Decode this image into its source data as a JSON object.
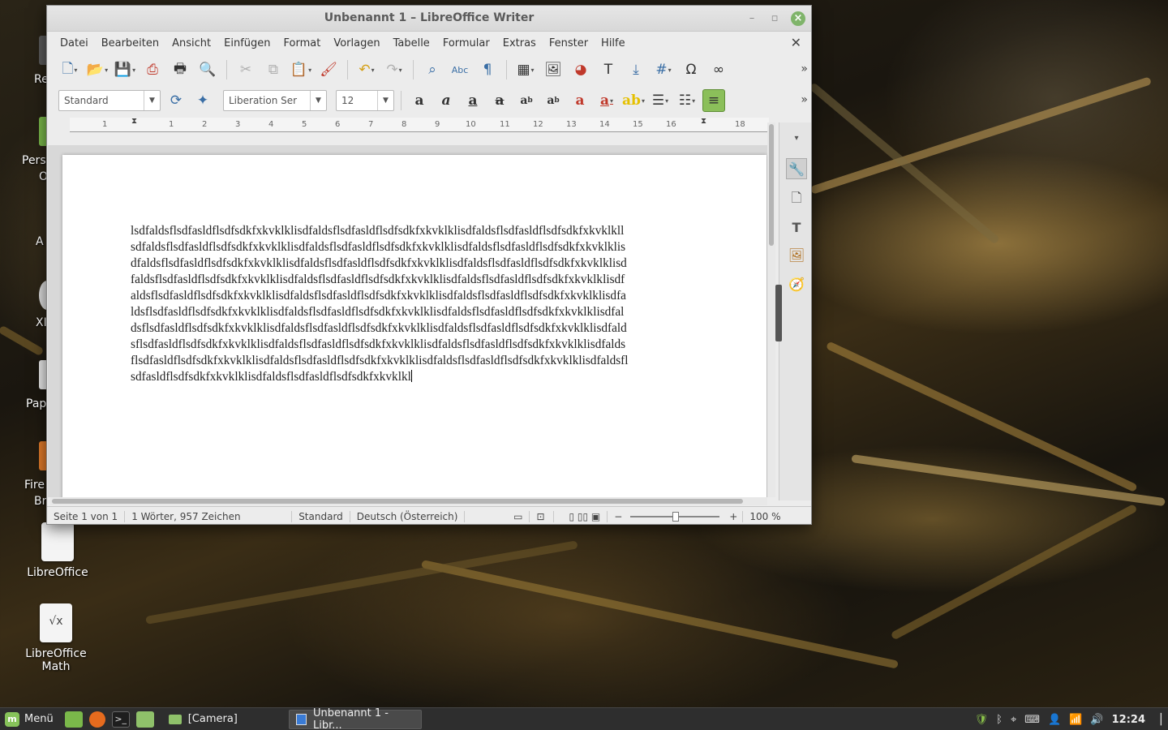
{
  "window": {
    "title": "Unbenannt 1 – LibreOffice Writer",
    "menus": [
      "Datei",
      "Bearbeiten",
      "Ansicht",
      "Einfügen",
      "Format",
      "Vorlagen",
      "Tabelle",
      "Formular",
      "Extras",
      "Fenster",
      "Hilfe"
    ],
    "paragraph_style": "Standard",
    "font_name": "Liberation Ser",
    "font_size": "12",
    "ruler_ticks": [
      "1",
      "1",
      "2",
      "3",
      "4",
      "5",
      "6",
      "7",
      "8",
      "9",
      "10",
      "11",
      "12",
      "13",
      "14",
      "15",
      "16",
      "17",
      "18"
    ]
  },
  "document": {
    "lines": [
      "lsdfaldsflsdfasldflsdfsdkfxkvklklisdfaldsflsdfasldflsdfsdkfxkvklklisdfaldsflsdfasldflsdfsdkfxkvklkll",
      "sdfaldsflsdfasldflsdfsdkfxkvklklisdfaldsflsdfasldflsdfsdkfxkvklklisdfaldsflsdfasldflsdfsdkfxkvklklis",
      "dfaldsflsdfasldflsdfsdkfxkvklklisdfaldsflsdfasldflsdfsdkfxkvklklisdfaldsflsdfasldflsdfsdkfxkvklklisd",
      "faldsflsdfasldflsdfsdkfxkvklklisdfaldsflsdfasldflsdfsdkfxkvklklisdfaldsflsdfasldflsdfsdkfxkvklklisdf",
      "aldsflsdfasldflsdfsdkfxkvklklisdfaldsflsdfasldflsdfsdkfxkvklklisdfaldsflsdfasldflsdfsdkfxkvklklisdfa",
      "ldsflsdfasldflsdfsdkfxkvklklisdfaldsflsdfasldflsdfsdkfxkvklklisdfaldsflsdfasldflsdfsdkfxkvklklisdfal",
      "dsflsdfasldflsdfsdkfxkvklklisdfaldsflsdfasldflsdfsdkfxkvklklisdfaldsflsdfasldflsdfsdkfxkvklklisdfald",
      "sflsdfasldflsdfsdkfxkvklklisdfaldsflsdfasldflsdfsdkfxkvklklisdfaldsflsdfasldflsdfsdkfxkvklklisdfalds",
      "flsdfasldflsdfsdkfxkvklklisdfaldsflsdfasldflsdfsdkfxkvklklisdfaldsflsdfasldflsdfsdkfxkvklklisdfaldsfl",
      "sdfasldflsdfsdkfxkvklklisdfaldsflsdfasldflsdfsdkfxkvklkl"
    ]
  },
  "status": {
    "page": "Seite 1 von 1",
    "words": "1 Wörter, 957 Zeichen",
    "style": "Standard",
    "language": "Deutsch (Österreich)",
    "zoom": "100 %"
  },
  "desktop": {
    "icons": [
      {
        "label": "LibreOffice",
        "glyph": ""
      },
      {
        "label": "LibreOffice Math",
        "glyph": "√x"
      }
    ],
    "peeks": [
      "Re",
      "Pers",
      "O",
      "A",
      "XI",
      "Pap",
      "Fire",
      "Br"
    ]
  },
  "taskbar": {
    "menu_label": "Menü",
    "tasks": [
      "[Camera]",
      "Unbenannt 1 - Libr..."
    ],
    "clock": "12:24"
  }
}
